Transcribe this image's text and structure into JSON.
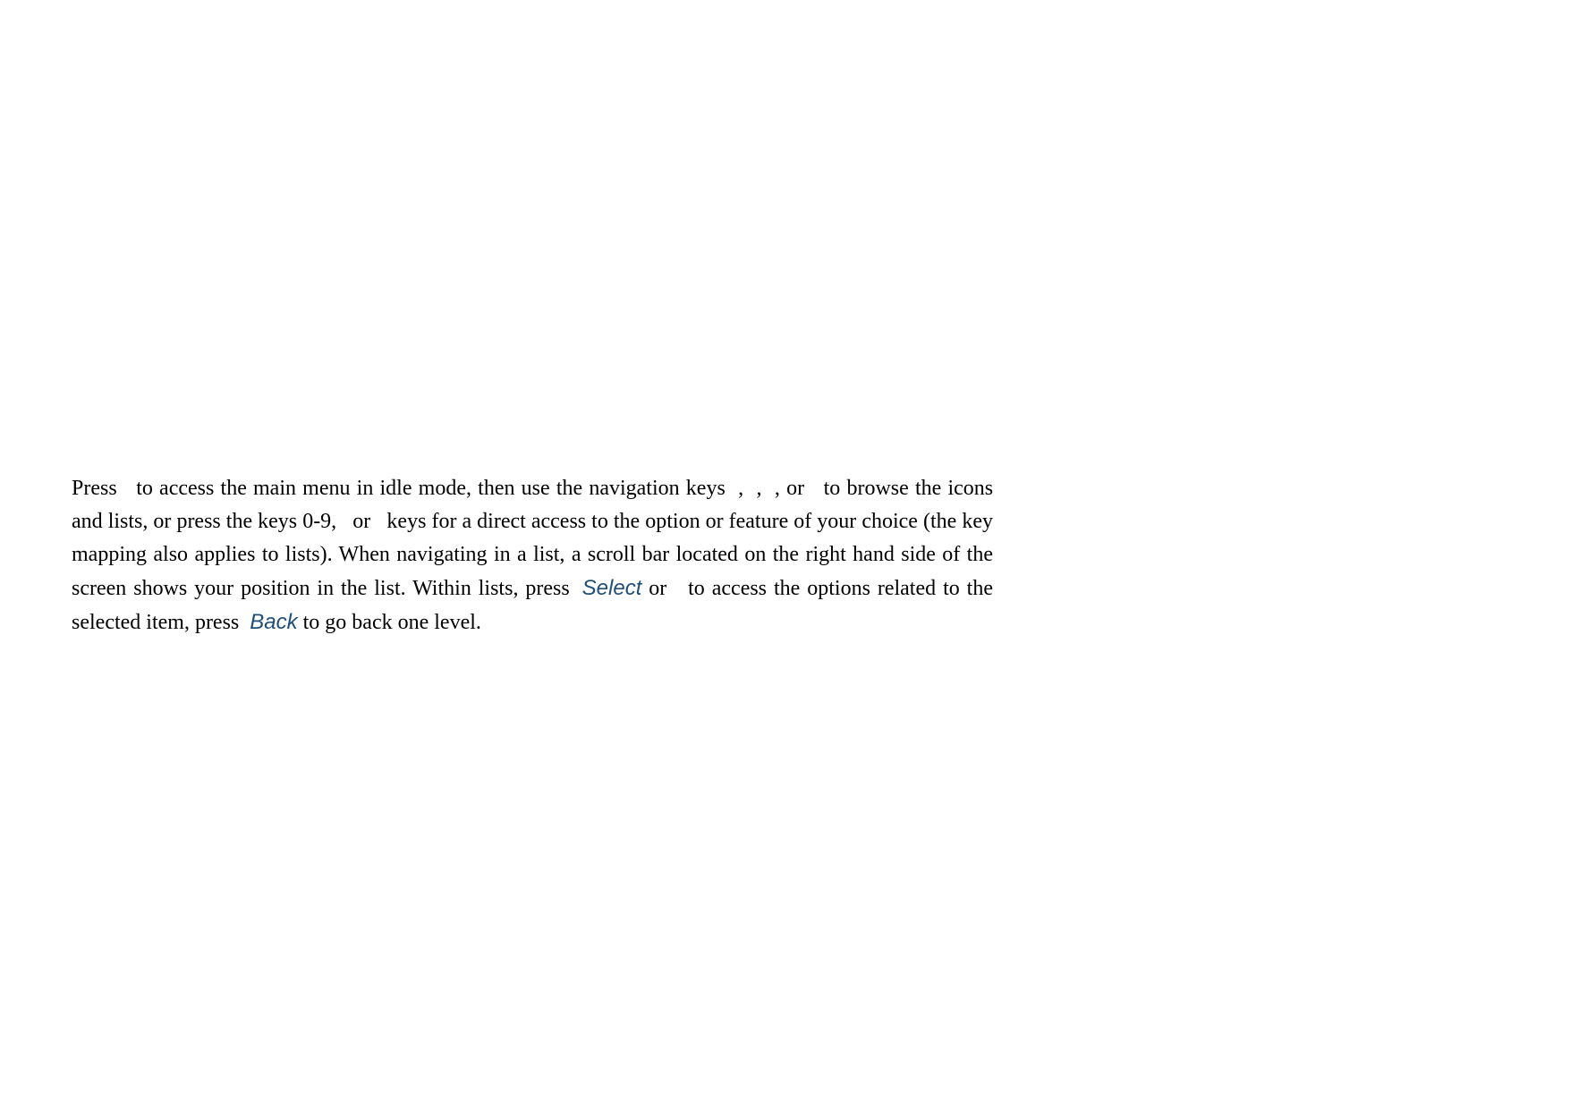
{
  "paragraph": {
    "t1": "Press ",
    "t2": " to access the main menu in idle mode, then use the navigation keys ",
    "t3": ", ",
    "t4": ", ",
    "t5": ", or ",
    "t6": " to browse the icons and lists, or press the keys 0-9, ",
    "t7": " or ",
    "t8": " keys for a direct access to the option or feature of your choice (the key mapping also applies to lists). When navigating in a list, a scroll bar located on the right hand side of the screen shows your position in the list. Within lists, press ",
    "soft_select": "Select",
    "t9": " or ",
    "t10": " to access the options related to the selected item, press ",
    "soft_back": "Back",
    "t11": " to go back one level."
  }
}
